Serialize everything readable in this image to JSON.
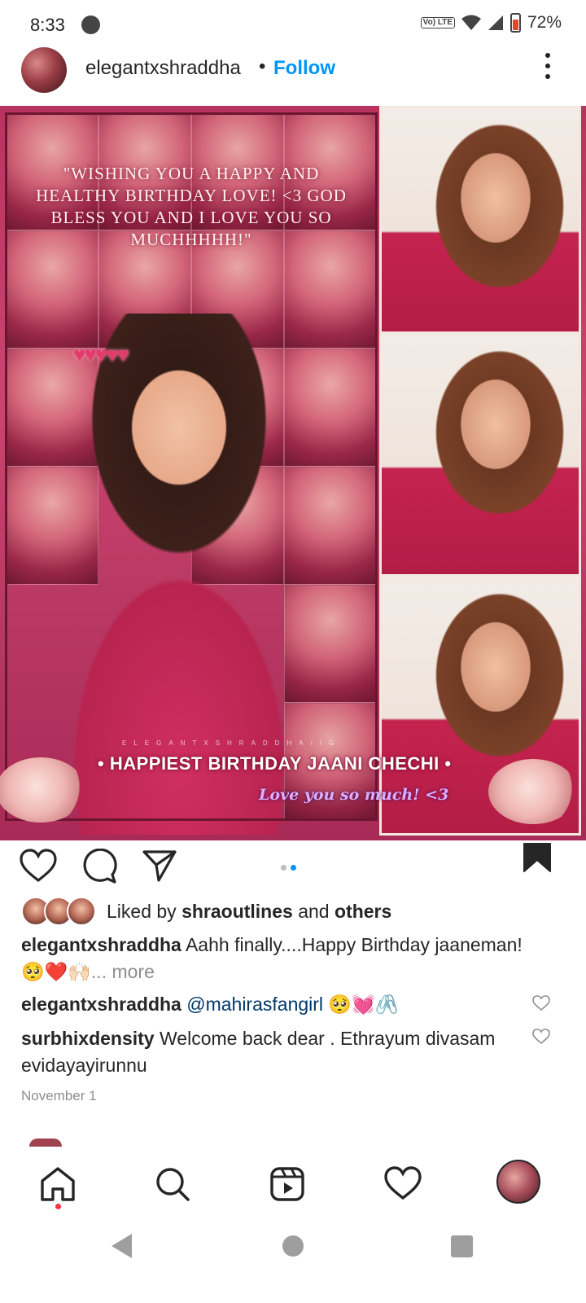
{
  "status_bar": {
    "time": "8:33",
    "network_badge": "Vo) LTE",
    "battery_percent": "72%",
    "icons": [
      "notification-dot-icon",
      "volte-icon",
      "wifi-icon",
      "signal-icon",
      "battery-icon"
    ]
  },
  "post": {
    "author": "elegantxshraddha",
    "separator": "•",
    "follow_label": "Follow",
    "image": {
      "quote": "\"WISHING YOU A HAPPY AND HEALTHY BIRTHDAY LOVE! <3 GOD BLESS YOU AND I LOVE YOU SO MUCHHHHH!\"",
      "watermark": "ELEGANTXSHRADDHA/IG",
      "banner": "• HAPPIEST BIRTHDAY JAANI CHECHI •",
      "banner_sub": "Love you so much! <3"
    },
    "carousel": {
      "count": 2,
      "active_index": 1
    },
    "liked_by": {
      "prefix": "Liked by",
      "user": "shraoutlines",
      "joiner": "and",
      "others": "others"
    },
    "caption": {
      "user": "elegantxshraddha",
      "text": "Aahh finally....Happy Birthday jaaneman!🥺❤️🙌🏻",
      "more": "... more"
    },
    "comments": [
      {
        "user": "elegantxshraddha",
        "mention": "@mahirasfangirl",
        "text": "🥺💓🖇️"
      },
      {
        "user": "surbhixdensity",
        "text": "Welcome back dear .  Ethrayum divasam evidayayirunnu"
      }
    ],
    "date": "November 1"
  },
  "bottom_nav": [
    "home-icon",
    "search-icon",
    "reels-icon",
    "activity-heart-icon",
    "profile-avatar"
  ],
  "colors": {
    "accent": "#0095f6",
    "text": "#262626",
    "muted": "#8e8e8e",
    "notification": "#ff3040"
  }
}
